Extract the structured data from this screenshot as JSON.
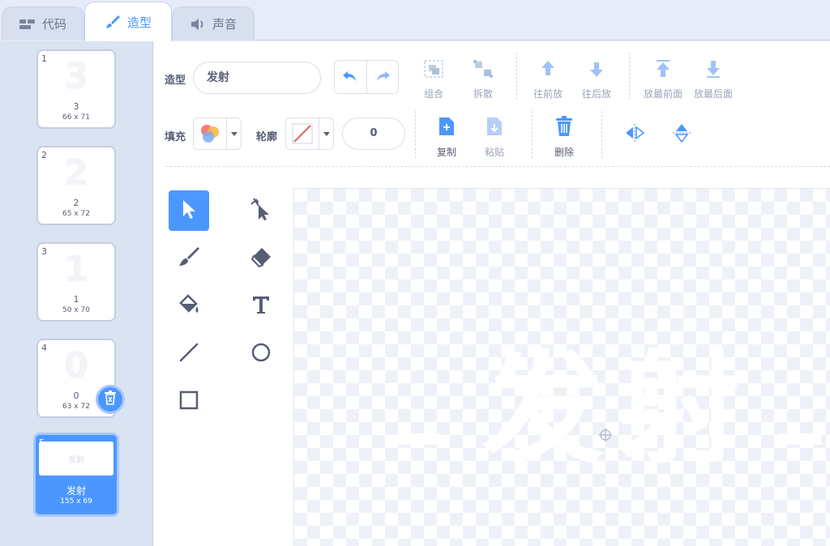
{
  "tabs": [
    {
      "label": "代码",
      "icon": "code-blocks-icon",
      "active": false
    },
    {
      "label": "造型",
      "icon": "paintbrush-icon",
      "active": true
    },
    {
      "label": "声音",
      "icon": "speaker-icon",
      "active": false
    }
  ],
  "costumes": [
    {
      "index": "1",
      "thumb": "3",
      "name": "3",
      "size": "66 x 71"
    },
    {
      "index": "2",
      "thumb": "2",
      "name": "2",
      "size": "65 x 72"
    },
    {
      "index": "3",
      "thumb": "1",
      "name": "1",
      "size": "50 x 70"
    },
    {
      "index": "4",
      "thumb": "0",
      "name": "0",
      "size": "63 x 72"
    },
    {
      "index": "5",
      "thumb": "发射",
      "name": "发射",
      "size": "155 x 69",
      "selected": true
    }
  ],
  "toolbar": {
    "costume_label": "造型",
    "costume_name": "发射",
    "group": "组合",
    "ungroup": "拆散",
    "forward": "往前放",
    "backward": "往后放",
    "front": "放最前面",
    "back": "放最后面",
    "fill_label": "填充",
    "outline_label": "轮廓",
    "outline_width": "0",
    "copy": "复制",
    "paste": "粘贴",
    "delete": "删除"
  },
  "canvas": {
    "text": "发射"
  },
  "colors": {
    "accent": "#4c97ff",
    "tab_bg": "#d8e0ef",
    "list_bg": "#d9e3f2"
  }
}
